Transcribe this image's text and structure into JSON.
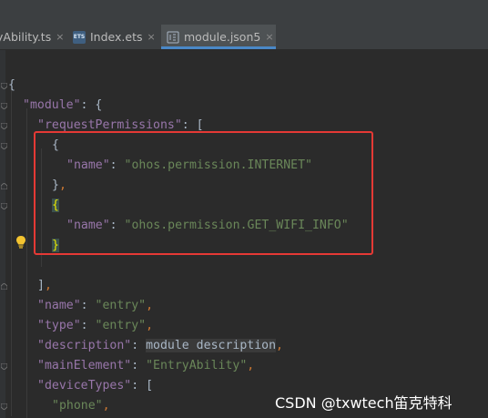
{
  "tabs": [
    {
      "label": "yAbility.ts",
      "active": false,
      "close": "×"
    },
    {
      "label": "Index.ets",
      "active": false,
      "close": "×",
      "icon": "ETS"
    },
    {
      "label": "module.json5",
      "active": true,
      "close": "×"
    }
  ],
  "code": {
    "l1_brace": "{",
    "l2_key": "\"module\"",
    "l2_rest": ": {",
    "l3_key": "\"requestPermissions\"",
    "l3_rest": ": [",
    "l4": "{",
    "l5_key": "\"name\"",
    "l5_colon": ": ",
    "l5_val": "\"ohos.permission.INTERNET\"",
    "l6_brace": "}",
    "l6_comma": ",",
    "l7": "{",
    "l8_key": "\"name\"",
    "l8_colon": ": ",
    "l8_val": "\"ohos.permission.GET_WIFI_INFO\"",
    "l9": "}",
    "l11_bracket": "]",
    "l11_comma": ",",
    "l12_key": "\"name\"",
    "l12_colon": ": ",
    "l12_val": "\"entry\"",
    "l12_comma": ",",
    "l13_key": "\"type\"",
    "l13_colon": ": ",
    "l13_val": "\"entry\"",
    "l13_comma": ",",
    "l14_key": "\"description\"",
    "l14_colon": ": ",
    "l14_val": "module description",
    "l14_comma": ",",
    "l15_key": "\"mainElement\"",
    "l15_colon": ": ",
    "l15_val": "\"EntryAbility\"",
    "l15_comma": ",",
    "l16_key": "\"deviceTypes\"",
    "l16_rest": ": [",
    "l17_val": "\"phone\"",
    "l17_comma": ","
  },
  "watermark": "CSDN @txwtech笛克特科",
  "colors": {
    "highlight_box": "#e53935",
    "string": "#6a8759",
    "key": "#9876aa",
    "punctuation": "#cc7832"
  }
}
